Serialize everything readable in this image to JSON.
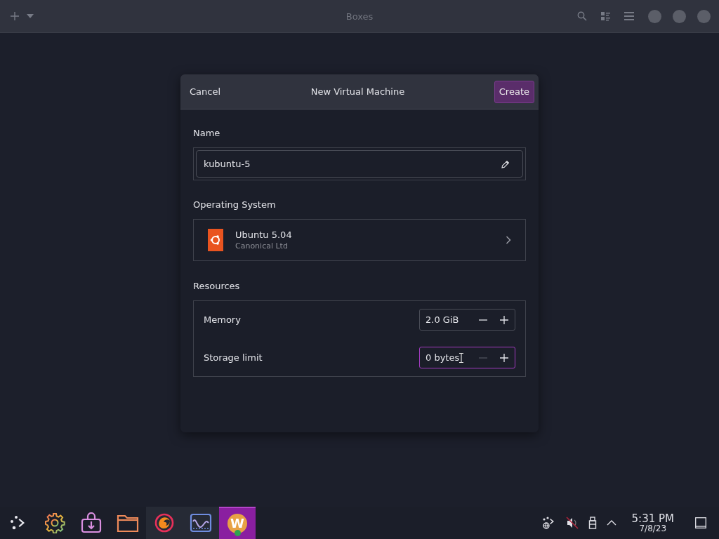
{
  "header_bar": {
    "title": "Boxes"
  },
  "dialog": {
    "title": "New Virtual Machine",
    "cancel": "Cancel",
    "create": "Create",
    "name": {
      "label": "Name",
      "value": "kubuntu-5"
    },
    "os": {
      "label": "Operating System",
      "name": "Ubuntu 5.04",
      "vendor": "Canonical Ltd"
    },
    "resources": {
      "label": "Resources",
      "rows": [
        {
          "label": "Memory",
          "value": "2.0 GiB",
          "focused": false,
          "minus_disabled": false
        },
        {
          "label": "Storage limit",
          "value": "0 bytes",
          "focused": true,
          "minus_disabled": true
        }
      ]
    }
  },
  "taskbar": {
    "apps": [
      {
        "kind": "launcher",
        "running": false,
        "selected": false
      },
      {
        "kind": "settings",
        "running": false,
        "selected": false
      },
      {
        "kind": "install",
        "running": false,
        "selected": false
      },
      {
        "kind": "folder",
        "running": false,
        "selected": false
      },
      {
        "kind": "browser",
        "running": true,
        "selected": false
      },
      {
        "kind": "monitor",
        "running": true,
        "selected": false
      },
      {
        "kind": "letter",
        "glyph": "W",
        "running": true,
        "selected": true
      }
    ],
    "tray": [
      {
        "kind": "network"
      },
      {
        "kind": "muted"
      },
      {
        "kind": "usb"
      },
      {
        "kind": "expand"
      }
    ],
    "time": "5:31 PM",
    "date": "7/8/23"
  }
}
